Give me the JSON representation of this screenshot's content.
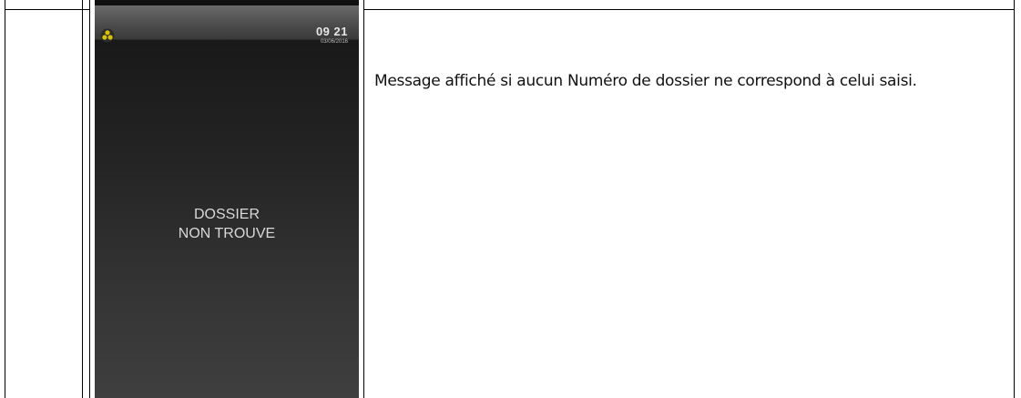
{
  "device_screen": {
    "clock_time": "09 21",
    "clock_date": "03/06/2016",
    "message_line1": "DOSSIER",
    "message_line2": "NON TROUVE",
    "status_icon": "tri-circle-warning-icon"
  },
  "description": {
    "text": "Message affiché si aucun Numéro de dossier ne correspond à celui saisi."
  },
  "colors": {
    "table_border": "#000000",
    "screen_background": "#2a2a2a",
    "status_icon": "#d8c200"
  }
}
